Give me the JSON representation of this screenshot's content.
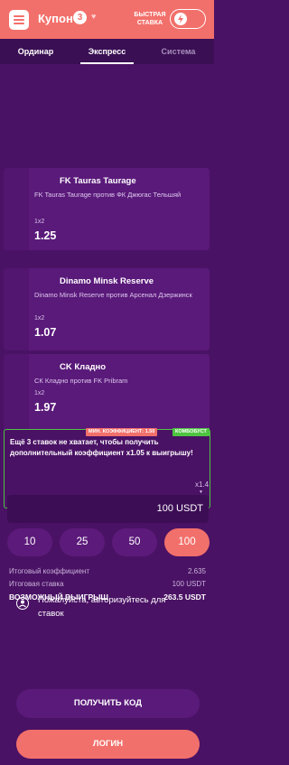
{
  "header": {
    "title": "Купон",
    "count": "3",
    "quick_bet_line1": "БЫСТРАЯ",
    "quick_bet_line2": "СТАВКА",
    "menu_icon": "hamburger-menu-icon",
    "toggle_icon": "lightning-icon",
    "accent_color": "#f2706b"
  },
  "tabs": [
    {
      "label": "Ординар"
    },
    {
      "label": "Экспресс"
    },
    {
      "label": "Система"
    }
  ],
  "bets": [
    {
      "team": "FK Tauras Taurage",
      "match": "FK Tauras Taurage против ФК Джюгас Тельшяй",
      "market": "1x2",
      "odds": "1.25"
    },
    {
      "team": "Dinamo Minsk Reserve",
      "match": "Dinamo Minsk Reserve против Арсенал Дзержинск",
      "market": "1x2",
      "odds": "1.07"
    },
    {
      "team": "CK Кладно",
      "match": "СК Кладно против FK Pribram",
      "market": "1x2",
      "odds": "1.97"
    }
  ],
  "bonus": {
    "badge_min": "МИН. КОЭФФИЦИЕНТ: 1.50",
    "badge_combo": "КОМБОБУСТ",
    "text": "Ещё 3 ставок не хватает, чтобы получить дополнительный коэффициент x1.05 к выигрышу!",
    "multiplier": "x1.4",
    "progress_segments_total": 9,
    "progress_segments_filled": 1,
    "filled_color": "#4fc441",
    "empty_color": "#6e6e7e"
  },
  "stake": {
    "value": "100 USDT"
  },
  "quick_amounts": [
    {
      "label": "10"
    },
    {
      "label": "25"
    },
    {
      "label": "50"
    },
    {
      "label": "100"
    }
  ],
  "summary": {
    "total_odds_label": "Итоговый коэффициент",
    "total_odds_value": "2.635",
    "total_stake_label": "Итоговая ставка",
    "total_stake_value": "100 USDT",
    "win_label": "ВОЗМОЖНЫЙ ВЫИГРЫШ",
    "win_value": "263.5 USDT"
  },
  "auth": {
    "text": "Пожалуйста, авторизуйтесь для ставок",
    "icon": "user-icon"
  },
  "buttons": {
    "get_code": "ПОЛУЧИТЬ КОД",
    "login": "ЛОГИН"
  }
}
